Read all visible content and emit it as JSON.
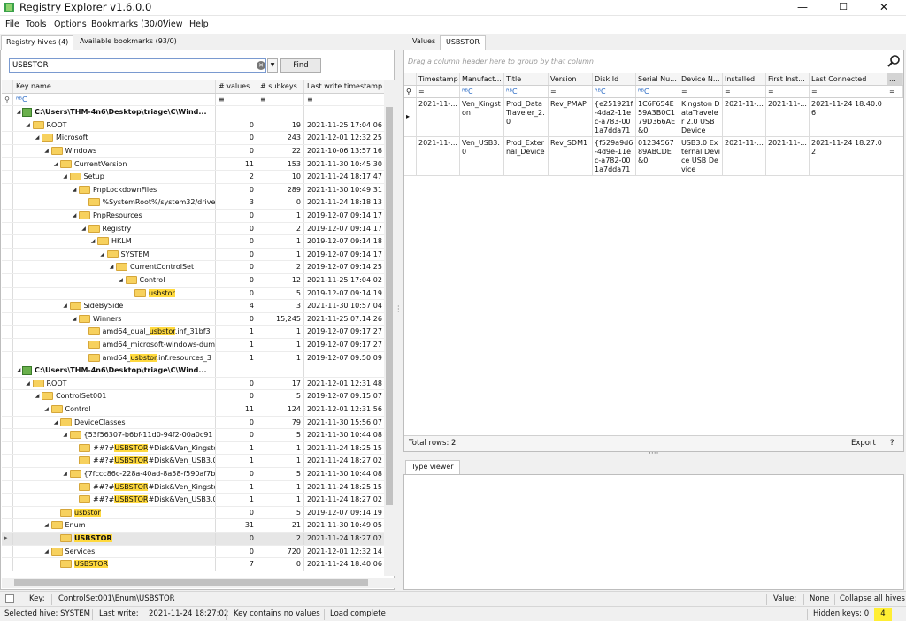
{
  "window": {
    "title": "Registry Explorer v1.6.0.0",
    "minimize": "—",
    "maximize": "☐",
    "close": "✕"
  },
  "menu": [
    "File",
    "Tools",
    "Options",
    "Bookmarks (30/0)",
    "View",
    "Help"
  ],
  "left_tabs": {
    "hives": "Registry hives (4)",
    "bookmarks": "Available bookmarks (93/0)"
  },
  "search": {
    "value": "USBSTOR",
    "find_label": "Find"
  },
  "tree": {
    "headers": {
      "key_name": "Key name",
      "values": "# values",
      "subkeys": "# subkeys",
      "timestamp": "Last write timestamp"
    },
    "filter_symbol": "≡",
    "filter_abc": "ᴿᴮC",
    "rows": [
      {
        "indent": 0,
        "type": "hive",
        "name": "C:\\Users\\THM-4n6\\Desktop\\triage\\C\\Wind...",
        "values": "",
        "subkeys": "",
        "ts": "",
        "bold": true
      },
      {
        "indent": 1,
        "type": "folder",
        "name": "ROOT",
        "values": "0",
        "subkeys": "19",
        "ts": "2021-11-25 17:04:06"
      },
      {
        "indent": 2,
        "type": "folder",
        "name": "Microsoft",
        "values": "0",
        "subkeys": "243",
        "ts": "2021-12-01 12:32:25"
      },
      {
        "indent": 3,
        "type": "folder",
        "name": "Windows",
        "values": "0",
        "subkeys": "22",
        "ts": "2021-10-06 13:57:16"
      },
      {
        "indent": 4,
        "type": "folder",
        "name": "CurrentVersion",
        "values": "11",
        "subkeys": "153",
        "ts": "2021-11-30 10:45:30"
      },
      {
        "indent": 5,
        "type": "folder",
        "name": "Setup",
        "values": "2",
        "subkeys": "10",
        "ts": "2021-11-24 18:17:47"
      },
      {
        "indent": 6,
        "type": "folder",
        "name": "PnpLockdownFiles",
        "values": "0",
        "subkeys": "289",
        "ts": "2021-11-30 10:49:31"
      },
      {
        "indent": 7,
        "type": "folder",
        "name": "%SystemRoot%/system32/drive",
        "values": "3",
        "subkeys": "0",
        "ts": "2021-11-24 18:18:13",
        "leaf": true
      },
      {
        "indent": 6,
        "type": "folder",
        "name": "PnpResources",
        "values": "0",
        "subkeys": "1",
        "ts": "2019-12-07 09:14:17"
      },
      {
        "indent": 7,
        "type": "folder",
        "name": "Registry",
        "values": "0",
        "subkeys": "2",
        "ts": "2019-12-07 09:14:17"
      },
      {
        "indent": 8,
        "type": "folder",
        "name": "HKLM",
        "values": "0",
        "subkeys": "1",
        "ts": "2019-12-07 09:14:18"
      },
      {
        "indent": 9,
        "type": "folder",
        "name": "SYSTEM",
        "values": "0",
        "subkeys": "1",
        "ts": "2019-12-07 09:14:17"
      },
      {
        "indent": 10,
        "type": "folder",
        "name": "CurrentControlSet",
        "values": "0",
        "subkeys": "2",
        "ts": "2019-12-07 09:14:25"
      },
      {
        "indent": 11,
        "type": "folder",
        "name": "Control",
        "values": "0",
        "subkeys": "12",
        "ts": "2021-11-25 17:04:02"
      },
      {
        "indent": 12,
        "type": "folder",
        "name": "usbstor",
        "values": "0",
        "subkeys": "5",
        "ts": "2019-12-07 09:14:19",
        "leaf": true,
        "hl": "full"
      },
      {
        "indent": 5,
        "type": "folder",
        "name": "SideBySide",
        "values": "4",
        "subkeys": "3",
        "ts": "2021-11-30 10:57:04"
      },
      {
        "indent": 6,
        "type": "folder",
        "name": "Winners",
        "values": "0",
        "subkeys": "15,245",
        "ts": "2021-11-25 07:14:26"
      },
      {
        "indent": 7,
        "type": "folder",
        "name": "amd64_dual_usbstor.inf_31bf3",
        "values": "1",
        "subkeys": "1",
        "ts": "2019-12-07 09:17:27",
        "leaf": true
      },
      {
        "indent": 7,
        "type": "folder",
        "name": "amd64_microsoft-windows-dum",
        "values": "1",
        "subkeys": "1",
        "ts": "2019-12-07 09:17:27",
        "leaf": true
      },
      {
        "indent": 7,
        "type": "folder",
        "name": "amd64_usbstor.inf.resources_3",
        "values": "1",
        "subkeys": "1",
        "ts": "2019-12-07 09:50:09",
        "leaf": true
      },
      {
        "indent": 0,
        "type": "hive",
        "name": "C:\\Users\\THM-4n6\\Desktop\\triage\\C\\Wind...",
        "values": "",
        "subkeys": "",
        "ts": "",
        "bold": true
      },
      {
        "indent": 1,
        "type": "folder",
        "name": "ROOT",
        "values": "0",
        "subkeys": "17",
        "ts": "2021-12-01 12:31:48"
      },
      {
        "indent": 2,
        "type": "folder",
        "name": "ControlSet001",
        "values": "0",
        "subkeys": "5",
        "ts": "2019-12-07 09:15:07"
      },
      {
        "indent": 3,
        "type": "folder",
        "name": "Control",
        "values": "11",
        "subkeys": "124",
        "ts": "2021-12-01 12:31:56"
      },
      {
        "indent": 4,
        "type": "folder",
        "name": "DeviceClasses",
        "values": "0",
        "subkeys": "79",
        "ts": "2021-11-30 15:56:07"
      },
      {
        "indent": 5,
        "type": "folder",
        "name": "{53f56307-b6bf-11d0-94f2-00a0c91",
        "values": "0",
        "subkeys": "5",
        "ts": "2021-11-30 10:44:08"
      },
      {
        "indent": 6,
        "type": "folder",
        "name": "##?#USBSTOR#Disk&Ven_Kingsto",
        "values": "1",
        "subkeys": "1",
        "ts": "2021-11-24 18:25:15",
        "leaf": true
      },
      {
        "indent": 6,
        "type": "folder",
        "name": "##?#USBSTOR#Disk&Ven_USB3.0",
        "values": "1",
        "subkeys": "1",
        "ts": "2021-11-24 18:27:02",
        "leaf": true
      },
      {
        "indent": 5,
        "type": "folder",
        "name": "{7fccc86c-228a-40ad-8a58-f590af7b",
        "values": "0",
        "subkeys": "5",
        "ts": "2021-11-30 10:44:08"
      },
      {
        "indent": 6,
        "type": "folder",
        "name": "##?#USBSTOR#Disk&Ven_Kingsto",
        "values": "1",
        "subkeys": "1",
        "ts": "2021-11-24 18:25:15",
        "leaf": true
      },
      {
        "indent": 6,
        "type": "folder",
        "name": "##?#USBSTOR#Disk&Ven_USB3.0",
        "values": "1",
        "subkeys": "1",
        "ts": "2021-11-24 18:27:02",
        "leaf": true
      },
      {
        "indent": 4,
        "type": "folder",
        "name": "usbstor",
        "values": "0",
        "subkeys": "5",
        "ts": "2019-12-07 09:14:19",
        "leaf": true
      },
      {
        "indent": 3,
        "type": "folder",
        "name": "Enum",
        "values": "31",
        "subkeys": "21",
        "ts": "2021-11-30 10:49:05"
      },
      {
        "indent": 4,
        "type": "folder",
        "name": "USBSTOR",
        "values": "0",
        "subkeys": "2",
        "ts": "2021-11-24 18:27:02",
        "leaf": true,
        "hl": "full",
        "bold": true,
        "selected": true
      },
      {
        "indent": 3,
        "type": "folder",
        "name": "Services",
        "values": "0",
        "subkeys": "720",
        "ts": "2021-12-01 12:32:14"
      },
      {
        "indent": 4,
        "type": "folder",
        "name": "USBSTOR",
        "values": "7",
        "subkeys": "0",
        "ts": "2021-11-24 18:40:06",
        "leaf": true,
        "hl": "full"
      }
    ]
  },
  "right_tabs": {
    "values": "Values",
    "usbstor": "USBSTOR"
  },
  "grid": {
    "group_hint": "Drag a column header here to group by that column",
    "columns": [
      "Timestamp",
      "Manufact...",
      "Title",
      "Version",
      "Disk Id",
      "Serial Nu...",
      "Device N...",
      "Installed",
      "First Inst...",
      "Last Connected",
      "..."
    ],
    "filter_eq": "=",
    "filter_abc": "ᴿᴮC",
    "rows": [
      [
        "2021-11-...",
        "Ven_Kingston",
        "Prod_DataTraveler_2.0",
        "Rev_PMAP",
        "{e251921f-4da2-11ec-a783-001a7dda7110}",
        "1C6F654E59A3B0C179D366AE&0",
        "Kingston DataTraveler 2.0 USB Device",
        "2021-11-...",
        "2021-11-...",
        "2021-11-24 18:40:06"
      ],
      [
        "2021-11-...",
        "Ven_USB3.0",
        "Prod_External_Device",
        "Rev_SDM1",
        "{f529a9d6-4d9e-11ec-a782-001a7dda7110}",
        "0123456789ABCDE&0",
        "USB3.0 External Device USB Device",
        "2021-11-...",
        "2021-11-...",
        "2021-11-24 18:27:02"
      ]
    ],
    "total_rows": "Total rows: 2",
    "export": "Export",
    "help": "?"
  },
  "type_viewer": {
    "tab": "Type viewer"
  },
  "keybar": {
    "key_label": "Key:",
    "key_value": "ControlSet001\\Enum\\USBSTOR",
    "value_label": "Value:",
    "value_value": "None",
    "collapse": "Collapse all hives"
  },
  "status": {
    "hive": "Selected hive: SYSTEM",
    "last_write_label": "Last write:",
    "last_write": "2021-11-24 18:27:02",
    "no_values": "Key contains no values",
    "load": "Load complete",
    "hidden_label": "Hidden keys: 0",
    "hidden_count": "4"
  }
}
